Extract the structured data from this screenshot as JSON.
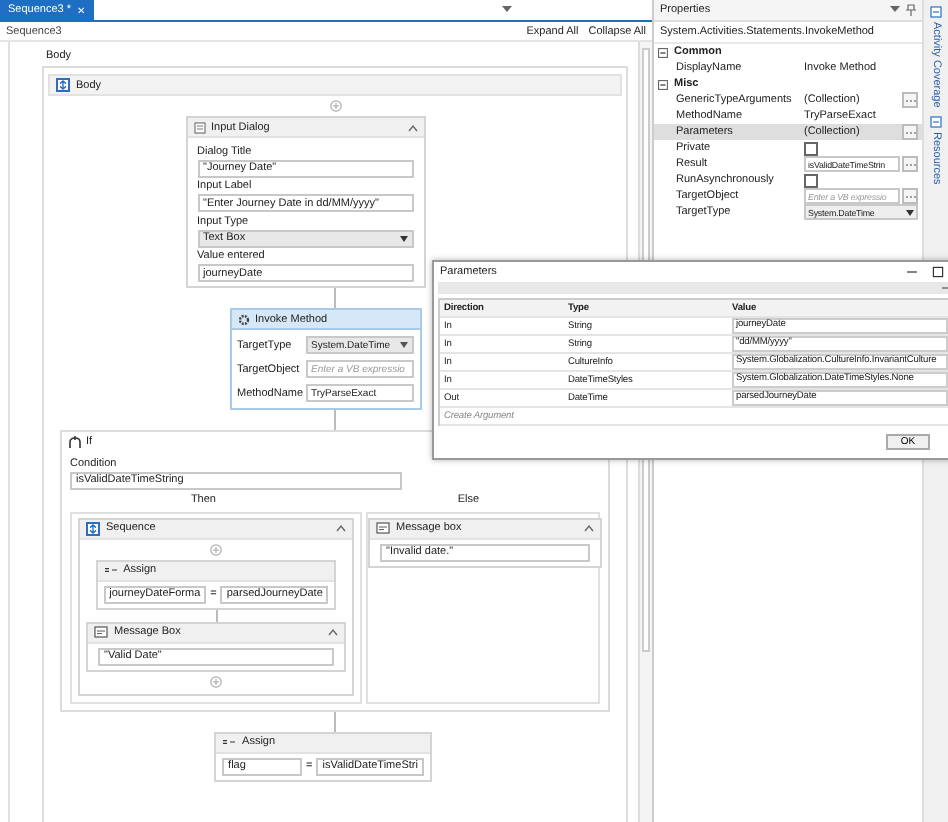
{
  "tab": {
    "title": "Sequence3 *",
    "close": "✕",
    "selected": true
  },
  "breadcrumb": "Sequence3",
  "toolbar": [
    "Expand All",
    "Collapse All"
  ],
  "designer": {
    "outer_label": "Body",
    "body_title": "Body",
    "input_dialog": {
      "title": "Input Dialog",
      "fields": [
        {
          "label": "Dialog Title",
          "value": "\"Journey Date\"",
          "kind": "text"
        },
        {
          "label": "Input Label",
          "value": "\"Enter Journey Date in dd/MM/yyyy\"",
          "kind": "text"
        },
        {
          "label": "Input Type",
          "value": "Text Box",
          "kind": "dropdown"
        },
        {
          "label": "Value entered",
          "value": "journeyDate",
          "kind": "text"
        }
      ]
    },
    "invoke_method": {
      "title": "Invoke Method",
      "fields": [
        {
          "label": "TargetType",
          "value": "System.DateTime",
          "kind": "dropdown"
        },
        {
          "label": "TargetObject",
          "placeholder": "Enter a VB expressio",
          "kind": "text"
        },
        {
          "label": "MethodName",
          "value": "TryParseExact",
          "kind": "text"
        }
      ]
    },
    "if": {
      "title": "If",
      "condition_label": "Condition",
      "condition": "isValidDateTimeString",
      "then_label": "Then",
      "else_label": "Else",
      "then": {
        "title": "Sequence",
        "assign": {
          "title": "Assign",
          "to": "journeyDateForma",
          "operator": "=",
          "value": "parsedJourneyDate"
        },
        "message_box": {
          "title": "Message Box",
          "text": "\"Valid Date\""
        }
      },
      "else": {
        "title": "Message box",
        "text": "\"Invalid date.\""
      }
    },
    "assign": {
      "title": "Assign",
      "to": "flag",
      "operator": "=",
      "value": "isValidDateTimeStri"
    }
  },
  "properties": {
    "title": "Properties",
    "type_name": "System.Activities.Statements.InvokeMethod",
    "categories": [
      {
        "name": "Common",
        "expanded": true,
        "rows": [
          {
            "name": "DisplayName",
            "kind": "text",
            "value": "Invoke Method",
            "selected": false
          }
        ]
      },
      {
        "name": "Misc",
        "expanded": true,
        "rows": [
          {
            "name": "GenericTypeArguments",
            "kind": "collection",
            "value": "(Collection)",
            "selected": false
          },
          {
            "name": "MethodName",
            "kind": "text",
            "value": "TryParseExact",
            "selected": false
          },
          {
            "name": "Parameters",
            "kind": "collection",
            "value": "(Collection)",
            "selected": true
          },
          {
            "name": "Private",
            "kind": "checkbox",
            "checked": false,
            "selected": false
          },
          {
            "name": "Result",
            "kind": "field",
            "value": "isValidDateTimeStrin",
            "selected": false
          },
          {
            "name": "RunAsynchronously",
            "kind": "checkbox",
            "checked": false,
            "selected": false
          },
          {
            "name": "TargetObject",
            "kind": "field",
            "placeholder": "Enter a VB expressio",
            "selected": false
          },
          {
            "name": "TargetType",
            "kind": "dropdown",
            "value": "System.DateTime",
            "selected": false
          }
        ]
      }
    ]
  },
  "side_tabs": [
    {
      "label": "Activity Coverage"
    },
    {
      "label": "Resources"
    }
  ],
  "dialog": {
    "title": "Parameters",
    "columns": [
      "Direction",
      "Type",
      "Value"
    ],
    "rows": [
      {
        "direction": "In",
        "type": "String",
        "value": "journeyDate"
      },
      {
        "direction": "In",
        "type": "String",
        "value": "\"dd/MM/yyyy\""
      },
      {
        "direction": "In",
        "type": "CultureInfo",
        "value": "System.Globalization.CultureInfo.InvariantCulture"
      },
      {
        "direction": "In",
        "type": "DateTimeStyles",
        "value": "System.Globalization.DateTimeStyles.None"
      },
      {
        "direction": "Out",
        "type": "DateTime",
        "value": "parsedJourneyDate"
      }
    ],
    "create_argument": "Create Argument",
    "buttons": [
      "OK"
    ]
  }
}
